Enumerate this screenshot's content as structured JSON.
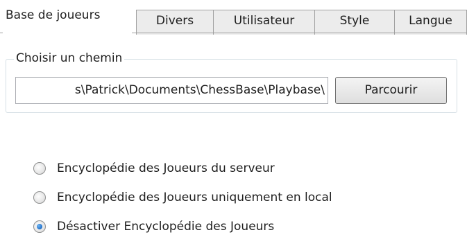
{
  "tabs": [
    {
      "label": "Base de joueurs",
      "active": true
    },
    {
      "label": "Divers",
      "active": false
    },
    {
      "label": "Utilisateur",
      "active": false
    },
    {
      "label": "Style",
      "active": false
    },
    {
      "label": "Langue",
      "active": false
    }
  ],
  "path_group": {
    "title": "Choisir un chemin",
    "path_value": "s\\Patrick\\Documents\\ChessBase\\Playbase\\",
    "browse_label": "Parcourir"
  },
  "options": [
    {
      "label": "Encyclopédie des Joueurs du serveur",
      "checked": false
    },
    {
      "label": "Encyclopédie des Joueurs uniquement en local",
      "checked": false
    },
    {
      "label": "Désactiver Encyclopédie des Joueurs",
      "checked": true
    }
  ]
}
